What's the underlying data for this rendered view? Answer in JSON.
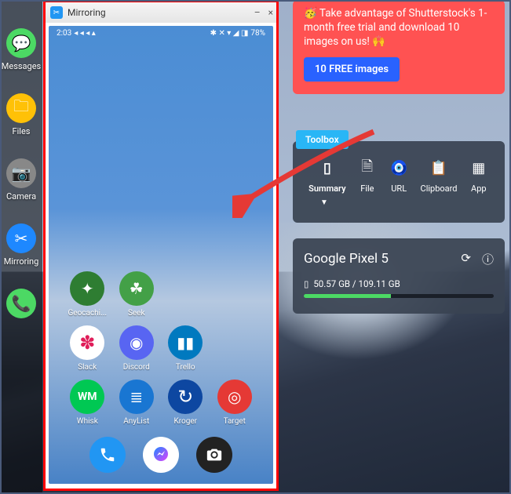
{
  "taskbar": {
    "items": [
      {
        "label": "Messages",
        "icon": "message"
      },
      {
        "label": "Files",
        "icon": "folder"
      },
      {
        "label": "Camera",
        "icon": "camera"
      },
      {
        "label": "Mirroring",
        "icon": "scissors"
      },
      {
        "label": "",
        "icon": "phone"
      }
    ]
  },
  "window": {
    "title": "Mirroring",
    "controls": {
      "minimize": "–",
      "close": "×"
    }
  },
  "phone": {
    "status": {
      "time": "2:03",
      "battery": "78%"
    },
    "apps": [
      {
        "label": "Geocachi...",
        "style": "ai-green",
        "glyph": "✦"
      },
      {
        "label": "Seek",
        "style": "ai-leaf",
        "glyph": "❥"
      },
      {
        "label": "Slack",
        "style": "ai-slack",
        "glyph": "❉"
      },
      {
        "label": "Discord",
        "style": "ai-discord",
        "glyph": "◉"
      },
      {
        "label": "Trello",
        "style": "ai-trello",
        "glyph": "▮▮"
      },
      {
        "label": "Whisk",
        "style": "ai-whisk",
        "glyph": "WM"
      },
      {
        "label": "AnyList",
        "style": "ai-anylist",
        "glyph": "≣"
      },
      {
        "label": "Kroger",
        "style": "ai-kroger",
        "glyph": "↺"
      },
      {
        "label": "Target",
        "style": "ai-target",
        "glyph": "◎"
      }
    ],
    "dock": [
      {
        "style": "ai-phone",
        "glyph": "phone"
      },
      {
        "style": "ai-msg",
        "glyph": "messenger"
      },
      {
        "style": "ai-cam",
        "glyph": "camera"
      }
    ]
  },
  "promo": {
    "text_prefix": "🥳 Take advantage of Shutterstock's 1-month free trial and download 10 images on us! 🙌",
    "button": "10 FREE images"
  },
  "toolbox": {
    "tag": "Toolbox",
    "tools": [
      {
        "label": "Summary",
        "icon": "▭"
      },
      {
        "label": "File",
        "icon": "📄"
      },
      {
        "label": "URL",
        "icon": "🔗"
      },
      {
        "label": "Clipboard",
        "icon": "📋"
      },
      {
        "label": "App",
        "icon": "▦"
      }
    ]
  },
  "device": {
    "name": "Google Pixel 5",
    "storage_text": "50.57 GB / 109.11 GB",
    "storage_pct": 46
  }
}
